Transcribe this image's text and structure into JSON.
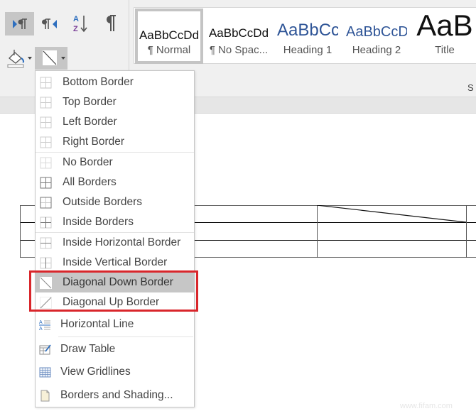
{
  "ribbon": {
    "paragraph_buttons": [
      {
        "name": "left-to-right-text-direction",
        "icon": "ltr-paragraph-icon",
        "active": true
      },
      {
        "name": "right-to-left-text-direction",
        "icon": "rtl-paragraph-icon",
        "active": false
      },
      {
        "name": "sort",
        "icon": "sort-az-icon",
        "active": false
      },
      {
        "name": "show-hide-formatting",
        "icon": "pilcrow-icon",
        "active": false
      }
    ],
    "shading_button": {
      "icon": "paint-bucket-icon"
    },
    "borders_button": {
      "icon": "diagonal-down-border-icon"
    },
    "styles_group_label_partial": "S"
  },
  "styles": [
    {
      "sample": "AaBbCcDd",
      "name": "¶ Normal",
      "selected": true
    },
    {
      "sample": "AaBbCcDd",
      "name": "¶ No Spac...",
      "selected": false
    },
    {
      "sample": "AaBbCc",
      "name": "Heading 1",
      "selected": false
    },
    {
      "sample": "AaBbCcD",
      "name": "Heading 2",
      "selected": false
    },
    {
      "sample": "AaB",
      "name": "Title",
      "selected": false
    }
  ],
  "borders_menu": {
    "items": [
      {
        "label": "Bottom Border",
        "icon": "bottom-border-icon"
      },
      {
        "label": "Top Border",
        "icon": "top-border-icon"
      },
      {
        "label": "Left Border",
        "icon": "left-border-icon"
      },
      {
        "label": "Right Border",
        "icon": "right-border-icon"
      },
      {
        "label": "No Border",
        "icon": "no-border-icon"
      },
      {
        "label": "All Borders",
        "icon": "all-borders-icon"
      },
      {
        "label": "Outside Borders",
        "icon": "outside-borders-icon"
      },
      {
        "label": "Inside Borders",
        "icon": "inside-borders-icon"
      },
      {
        "label": "Inside Horizontal Border",
        "icon": "inside-horizontal-border-icon"
      },
      {
        "label": "Inside Vertical Border",
        "icon": "inside-vertical-border-icon"
      },
      {
        "label": "Diagonal Down Border",
        "icon": "diagonal-down-border-icon",
        "hovered": true
      },
      {
        "label": "Diagonal Up Border",
        "icon": "diagonal-up-border-icon"
      },
      {
        "label": "Horizontal Line",
        "icon": "horizontal-line-icon"
      },
      {
        "label": "Draw Table",
        "icon": "draw-table-icon"
      },
      {
        "label": "View Gridlines",
        "icon": "view-gridlines-icon"
      },
      {
        "label": "Borders and Shading...",
        "icon": "borders-and-shading-icon"
      }
    ],
    "highlight_color": "#d9262b",
    "hover_color": "#c6c6c6"
  },
  "watermark": "www.fifam.com"
}
